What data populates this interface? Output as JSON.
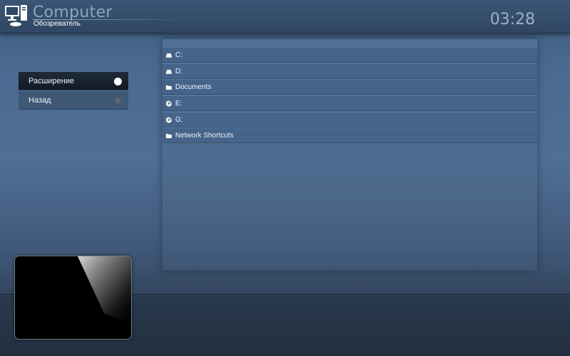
{
  "header": {
    "title": "Computer",
    "subtitle": "Обозреватель",
    "clock": "03:28",
    "icon": "computer-icon"
  },
  "menu": {
    "items": [
      {
        "label": "Расширение",
        "selected": true
      },
      {
        "label": "Назад",
        "selected": false
      }
    ]
  },
  "file_list": {
    "items": [
      {
        "label": "C:",
        "icon": "drive-icon"
      },
      {
        "label": "D:",
        "icon": "drive-icon"
      },
      {
        "label": "Documents",
        "icon": "folder-icon"
      },
      {
        "label": "E:",
        "icon": "disc-icon"
      },
      {
        "label": "G:",
        "icon": "disc-icon"
      },
      {
        "label": "Network Shortcuts",
        "icon": "folder-icon"
      }
    ]
  },
  "colors": {
    "accent_text": "#8ea5bf",
    "header_bg": "#2f4763",
    "active_item_bg": "#121a24"
  }
}
